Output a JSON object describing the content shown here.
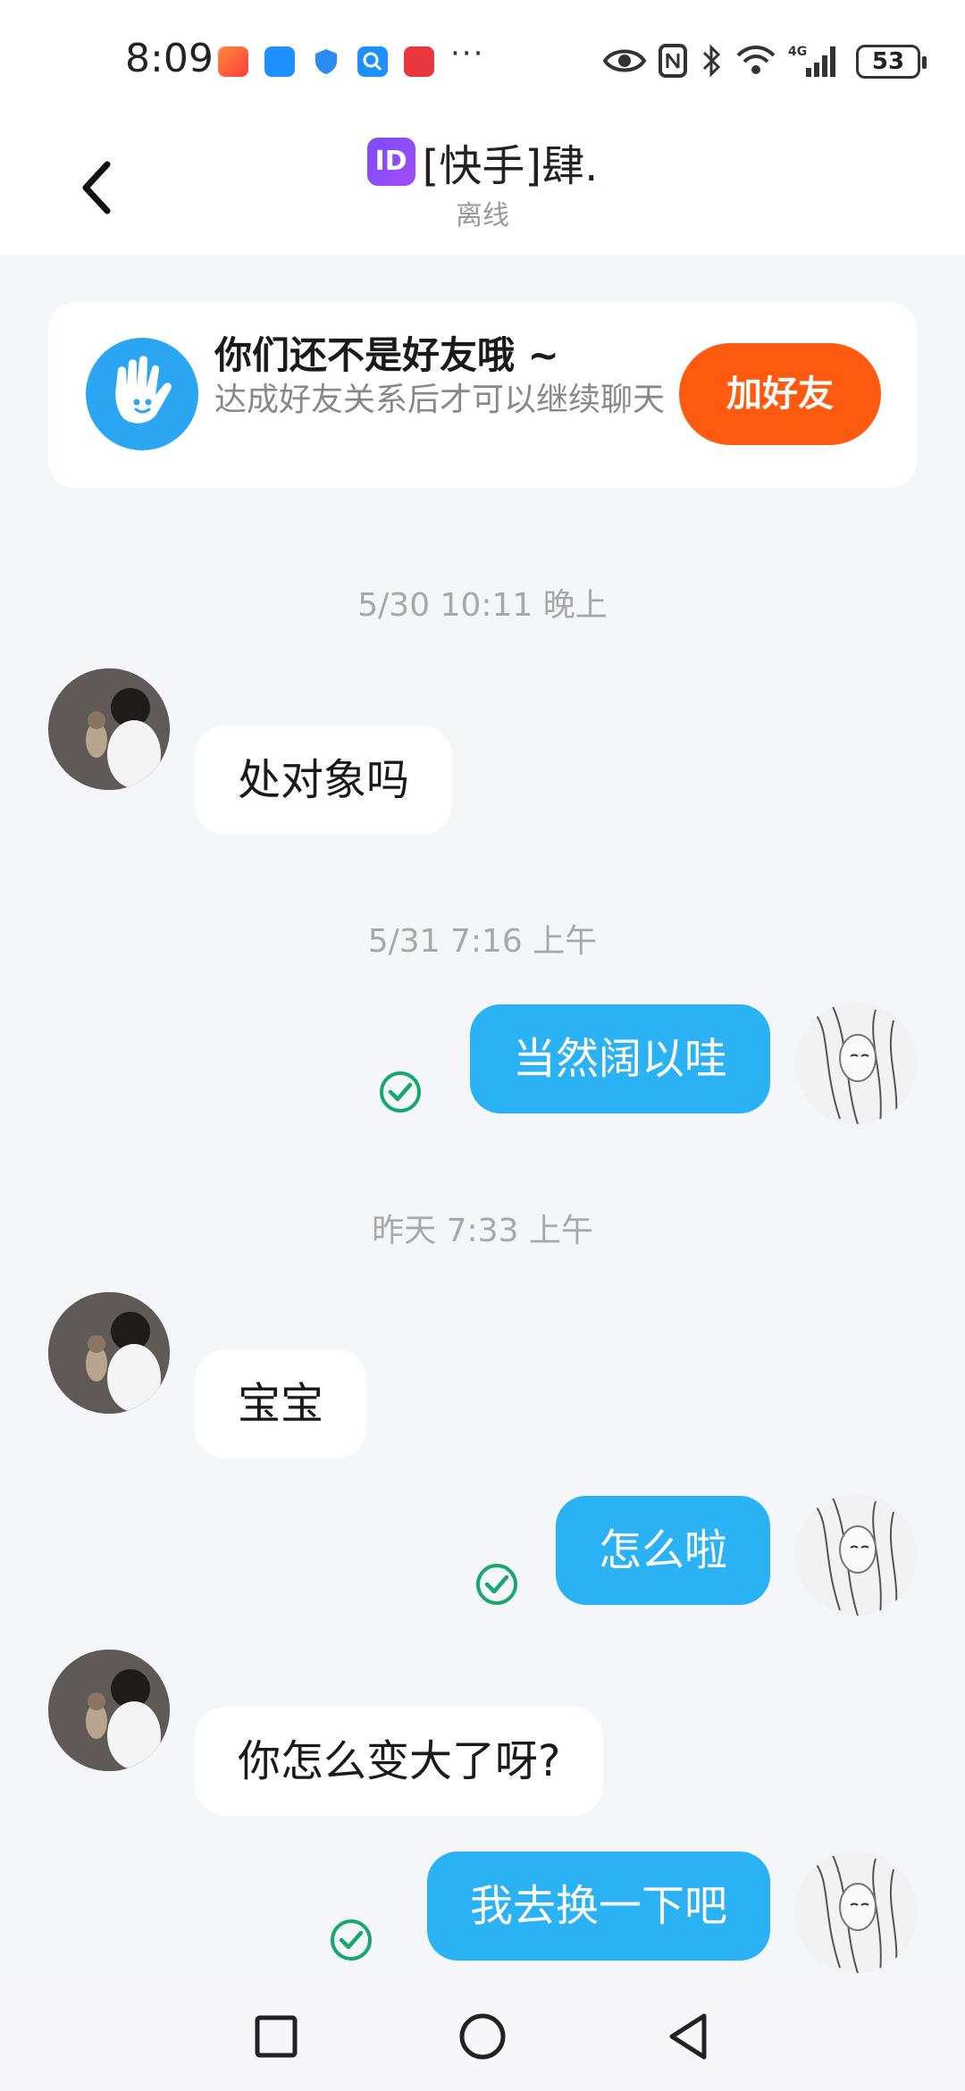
{
  "status_bar": {
    "time": "8:09",
    "more": "···",
    "battery": "53",
    "icons": [
      "kuaishou-app-icon",
      "message-app-icon",
      "shield-app-icon",
      "search-app-icon",
      "book-app-icon",
      "eye-icon",
      "nfc-icon",
      "bluetooth-icon",
      "wifi-icon",
      "4g-signal-icon",
      "battery-icon"
    ]
  },
  "header": {
    "id_badge": "ID",
    "title": "[快手]肆.",
    "status": "离线",
    "back_icon": "back-arrow-icon"
  },
  "banner": {
    "title": "你们还不是好友哦 ~",
    "description": "达成好友关系后才可以继续聊天",
    "button": "加好友",
    "icon": "waving-hand-icon"
  },
  "messages": [
    {
      "type": "timestamp",
      "text": "5/30 10:11 晚上"
    },
    {
      "type": "incoming",
      "text": "处对象吗"
    },
    {
      "type": "timestamp",
      "text": "5/31 7:16 上午"
    },
    {
      "type": "outgoing",
      "text": "当然阔以哇",
      "status": "read"
    },
    {
      "type": "timestamp",
      "text": "昨天 7:33 上午"
    },
    {
      "type": "incoming",
      "text": "宝宝"
    },
    {
      "type": "outgoing",
      "text": "怎么啦",
      "status": "read"
    },
    {
      "type": "incoming",
      "text": "你怎么变大了呀?"
    },
    {
      "type": "outgoing",
      "text": "我去换一下吧",
      "status": "read"
    }
  ],
  "colors": {
    "accent_blue": "#2ab2f5",
    "add_button": "#ff5b10",
    "read_check": "#17a86b",
    "background": "#f5f6f9"
  },
  "nav_bar": {
    "buttons": [
      "recents-square-icon",
      "home-circle-icon",
      "back-triangle-icon"
    ]
  }
}
